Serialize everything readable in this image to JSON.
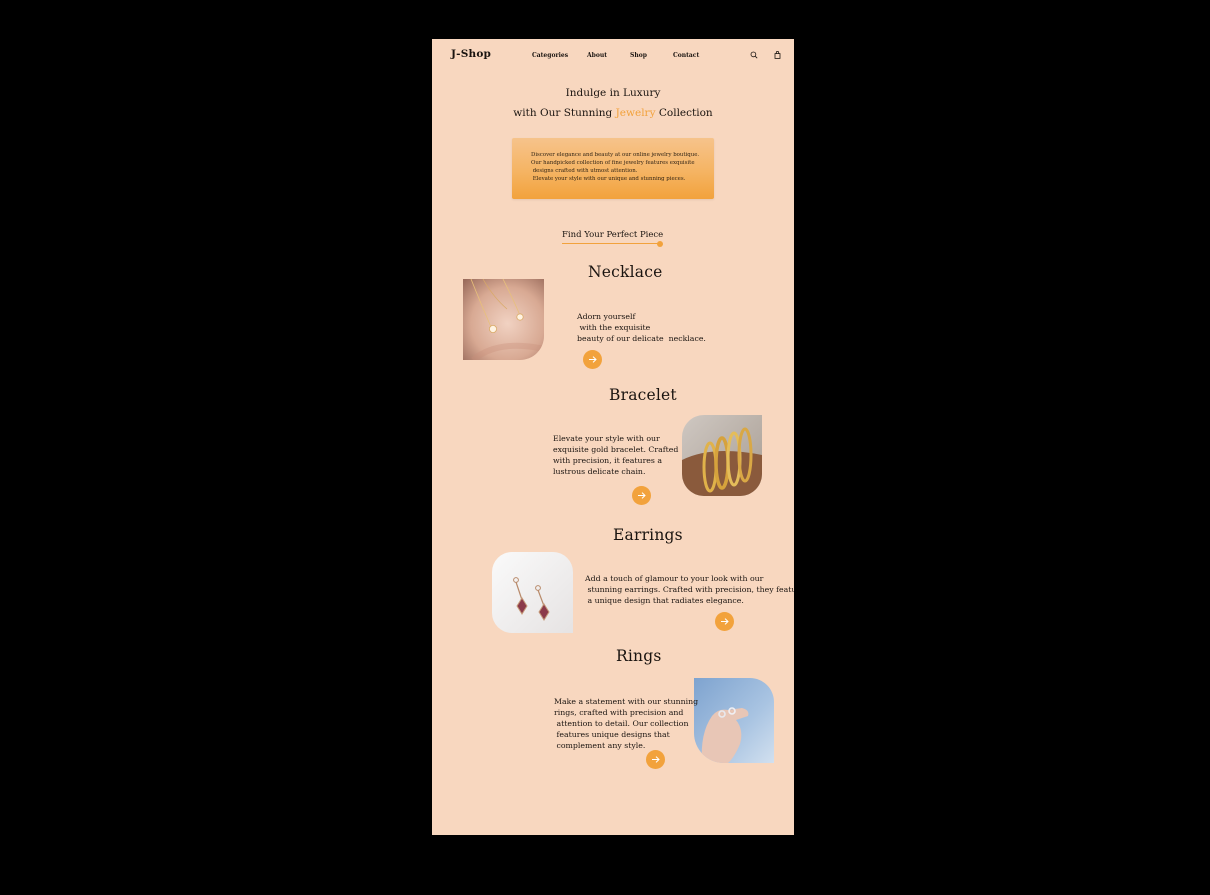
{
  "brand": {
    "logo": "J-Shop"
  },
  "nav": {
    "links": [
      "Categories",
      "About",
      "Shop",
      "Contact"
    ],
    "search_icon": "search-icon",
    "bag_icon": "shopping-bag-icon"
  },
  "hero": {
    "line1": "Indulge in Luxury",
    "line2_before": "with Our Stunning ",
    "line2_accent": "Jewelry",
    "line2_after": " Collection"
  },
  "promo": {
    "text": "Discover elegance and beauty at our online jewelry boutique.\nOur handpicked collection of fine jewelry features exquisite\n designs crafted with utmost attention.\n Elevate your style with our unique and stunning pieces."
  },
  "finder": {
    "label": "Find Your Perfect Piece"
  },
  "categories": [
    {
      "title": "Necklace",
      "desc": "Adorn yourself\n with the exquisite\nbeauty of our delicate  necklace."
    },
    {
      "title": "Bracelet",
      "desc": "Elevate your style with our\nexquisite gold bracelet. Crafted\nwith precision, it features a\nlustrous delicate chain."
    },
    {
      "title": "Earrings",
      "desc": "Add a touch of glamour to your look with our\n stunning earrings. Crafted with precision, they feature\n a unique design that radiates elegance."
    },
    {
      "title": "Rings",
      "desc": "Make a statement with our stunning\nrings, crafted with precision and\n attention to detail. Our collection\n features unique designs that\n complement any style."
    }
  ],
  "colors": {
    "background": "#f8d7bf",
    "accent": "#f2a23c",
    "frame": "#000000",
    "text": "#1a1410"
  }
}
